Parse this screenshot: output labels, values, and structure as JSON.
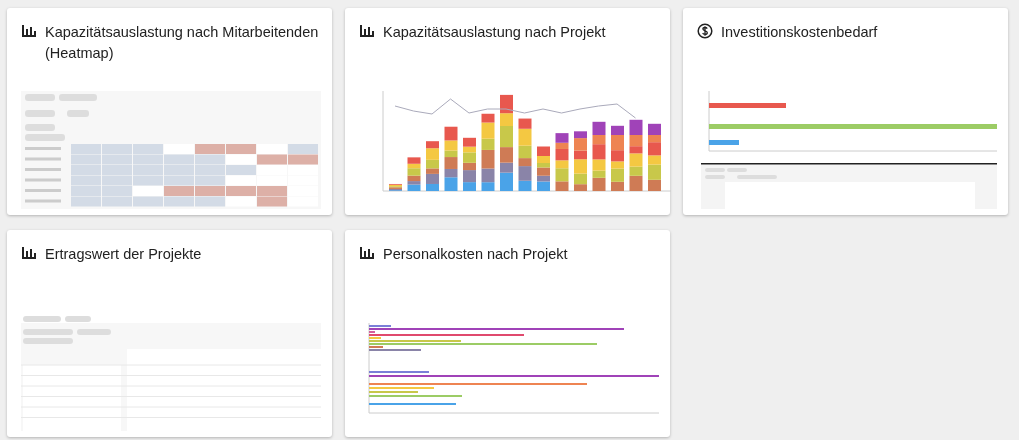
{
  "cards": [
    {
      "title": "Kapazitätsauslastung nach Mitarbeitenden (Heatmap)",
      "kind": "heatmap"
    },
    {
      "title": "Kapazitätsauslastung nach Projekt",
      "kind": "stacked_bars"
    },
    {
      "title": "Investitionskostenbedarf",
      "kind": "cost_bars"
    },
    {
      "title": "Ertragswert der Projekte",
      "kind": "pivot_table"
    },
    {
      "title": "Personalkosten nach Projekt",
      "kind": "grouped_bars"
    }
  ]
}
